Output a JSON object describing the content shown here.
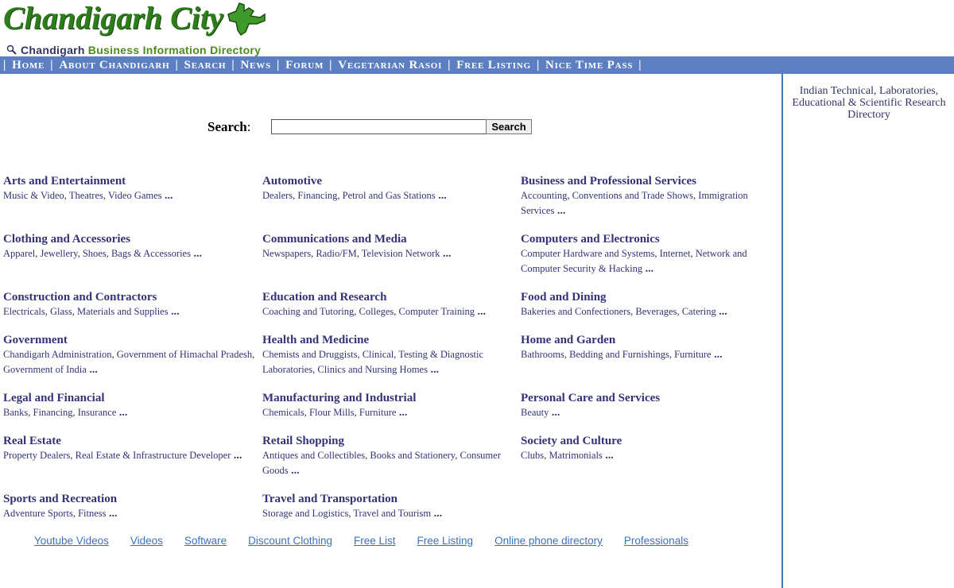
{
  "header": {
    "logo_text": "Chandigarh City",
    "tagline_part1": "Chandigarh",
    "tagline_part2": "Business Information Directory",
    "colors": {
      "logo": "#2e7d1c",
      "nav_bg": "#5b7fc0",
      "link": "#333377"
    }
  },
  "nav": {
    "sep": "|",
    "items": [
      "Home",
      "About Chandigarh",
      "Search",
      "News",
      "Forum",
      "Vegetarian Rasoi",
      "Free Listing",
      "Nice Time Pass"
    ]
  },
  "search": {
    "label": "Search",
    "colon": ":",
    "value": "",
    "button_label": "Search"
  },
  "sidebar": {
    "link": "Indian Technical, Laboratories, Educational & Scientific Research Directory"
  },
  "more": "...",
  "comma": ",",
  "categories": [
    {
      "title": "Arts and Entertainment",
      "subs": [
        "Music & Video",
        "Theatres",
        "Video Games"
      ]
    },
    {
      "title": "Automotive",
      "subs": [
        "Dealers",
        "Financing",
        "Petrol and Gas Stations"
      ]
    },
    {
      "title": "Business and Professional Services",
      "subs": [
        "Accounting",
        "Conventions and Trade Shows",
        "Immigration Services"
      ]
    },
    {
      "title": "Clothing and Accessories",
      "subs": [
        "Apparel",
        "Jewellery",
        "Shoes, Bags & Accessories"
      ]
    },
    {
      "title": "Communications and Media",
      "subs": [
        "Newspapers",
        "Radio/FM",
        "Television Network"
      ]
    },
    {
      "title": "Computers and Electronics",
      "subs": [
        "Computer Hardware and Systems",
        "Internet",
        "Network and Computer Security & Hacking"
      ]
    },
    {
      "title": "Construction and Contractors",
      "subs": [
        "Electricals",
        "Glass",
        "Materials and Supplies"
      ]
    },
    {
      "title": "Education and Research",
      "subs": [
        "Coaching and Tutoring",
        "Colleges",
        "Computer Training"
      ]
    },
    {
      "title": "Food and Dining",
      "subs": [
        "Bakeries and Confectioners",
        "Beverages",
        "Catering"
      ]
    },
    {
      "title": "Government",
      "subs": [
        "Chandigarh Administration",
        "Government of Himachal Pradesh",
        "Government of India"
      ]
    },
    {
      "title": "Health and Medicine",
      "subs": [
        "Chemists and Druggists",
        "Clinical, Testing & Diagnostic Laboratories",
        "Clinics and Nursing Homes"
      ]
    },
    {
      "title": "Home and Garden",
      "subs": [
        "Bathrooms",
        "Bedding and Furnishings",
        "Furniture"
      ]
    },
    {
      "title": "Legal and Financial",
      "subs": [
        "Banks",
        "Financing",
        "Insurance"
      ]
    },
    {
      "title": "Manufacturing and Industrial",
      "subs": [
        "Chemicals",
        "Flour Mills",
        "Furniture"
      ]
    },
    {
      "title": "Personal Care and Services",
      "subs": [
        "Beauty"
      ]
    },
    {
      "title": "Real Estate",
      "subs": [
        "Property Dealers",
        "Real Estate & Infrastructure Developer"
      ]
    },
    {
      "title": "Retail Shopping",
      "subs": [
        "Antiques and Collectibles",
        "Books and Stationery",
        "Consumer Goods"
      ]
    },
    {
      "title": "Society and Culture",
      "subs": [
        "Clubs",
        "Matrimonials"
      ]
    },
    {
      "title": "Sports and Recreation",
      "subs": [
        "Adventure Sports",
        "Fitness"
      ]
    },
    {
      "title": "Travel and Transportation",
      "subs": [
        "Storage and Logistics",
        "Travel and Tourism"
      ]
    }
  ],
  "footer_links": [
    "Youtube Videos",
    "Videos",
    "Software",
    "Discount Clothing",
    "Free List",
    "Free Listing",
    "Online phone directory",
    "Professionals"
  ]
}
